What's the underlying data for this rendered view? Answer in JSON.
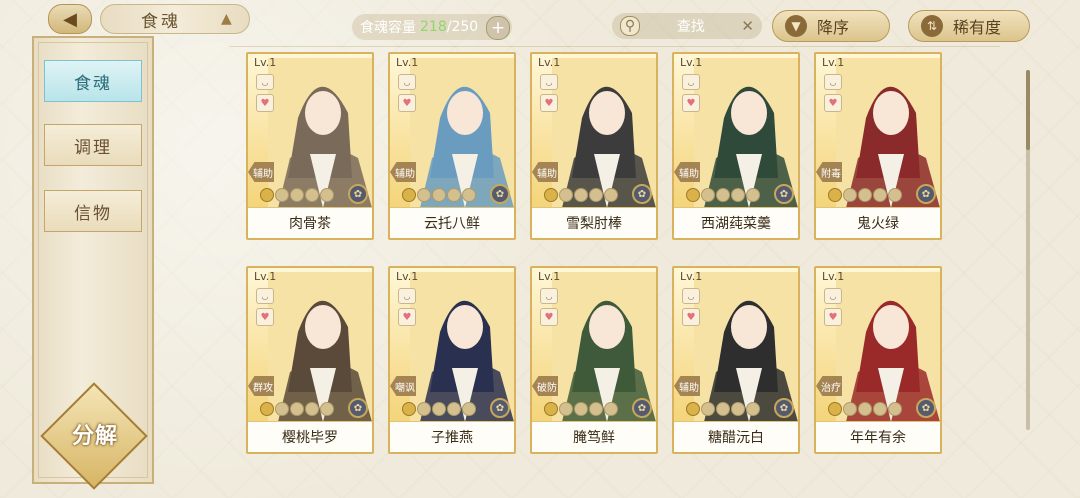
{
  "header": {
    "back_icon": "back-arrow-icon",
    "title": "食魂",
    "capacity_label": "食魂容量",
    "capacity_current": "218",
    "capacity_max": "/250",
    "add_symbol": "+",
    "search_placeholder": "查找",
    "search_clear": "✕",
    "sort_order_label": "降序",
    "sort_field_label": "稀有度"
  },
  "sidebar": {
    "items": [
      {
        "label": "食魂",
        "active": true
      },
      {
        "label": "调理",
        "active": false
      },
      {
        "label": "信物",
        "active": false
      }
    ],
    "decompose_label": "分解"
  },
  "cards": [
    {
      "level": "Lv.1",
      "role": "辅助",
      "name": "肉骨茶",
      "color": "#7a6a5a"
    },
    {
      "level": "Lv.1",
      "role": "辅助",
      "name": "云托八鲜",
      "color": "#6a9cc0"
    },
    {
      "level": "Lv.1",
      "role": "辅助",
      "name": "雪梨肘棒",
      "color": "#3c3c3c"
    },
    {
      "level": "Lv.1",
      "role": "辅助",
      "name": "西湖莼菜羹",
      "color": "#2f4a3a"
    },
    {
      "level": "Lv.1",
      "role": "附毒",
      "name": "鬼火绿",
      "color": "#8a2a2a"
    },
    {
      "level": "Lv.1",
      "role": "群攻",
      "name": "樱桃毕罗",
      "color": "#5b4a3a"
    },
    {
      "level": "Lv.1",
      "role": "嘲讽",
      "name": "子推燕",
      "color": "#2a3050"
    },
    {
      "level": "Lv.1",
      "role": "破防",
      "name": "腌笃鲜",
      "color": "#3f5a3a"
    },
    {
      "level": "Lv.1",
      "role": "辅助",
      "name": "糖醋沅白",
      "color": "#2e2e2e"
    },
    {
      "level": "Lv.1",
      "role": "治疗",
      "name": "年年有余",
      "color": "#9a2a2a"
    }
  ]
}
